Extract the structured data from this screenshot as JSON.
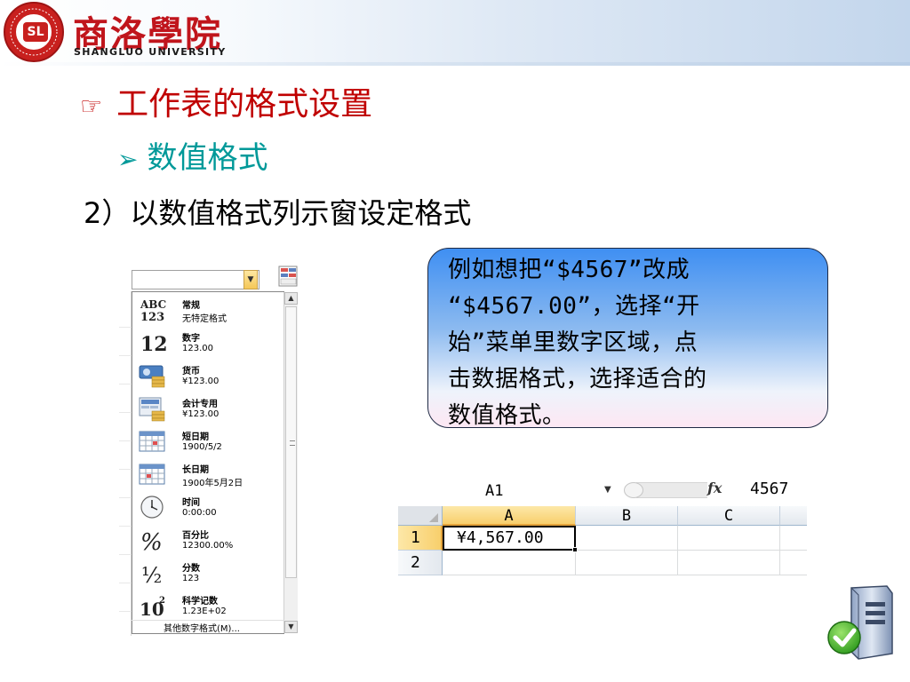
{
  "header": {
    "school_name_cn": "商洛學院",
    "school_name_en": "SHANGLUO UNIVERSITY",
    "seal_letters": "SL",
    "seal_ring_text": "SHANGLUO UNIVERSITY"
  },
  "title_main": "工作表的格式设置",
  "title_main_bullet": "☞",
  "title_sub": "数值格式",
  "title_sub_bullet": "➢",
  "subtitle_step": "2）以数值格式列示窗设定格式",
  "callout": {
    "lines": [
      "例如想把“$4567”改成",
      "“$4567.00”，选择“开",
      "始”菜单里数字区域，点",
      "击数据格式，选择适合的",
      "数值格式。"
    ]
  },
  "format_dropdown": {
    "items": [
      {
        "name": "常规",
        "example": "无特定格式",
        "icon": "abc123-icon"
      },
      {
        "name": "数字",
        "example": "123.00",
        "icon": "number-12-icon"
      },
      {
        "name": "货币",
        "example": "¥123.00",
        "icon": "currency-icon"
      },
      {
        "name": "会计专用",
        "example": "¥123.00",
        "icon": "accounting-icon"
      },
      {
        "name": "短日期",
        "example": "1900/5/2",
        "icon": "short-date-calendar-icon"
      },
      {
        "name": "长日期",
        "example": "1900年5月2日",
        "icon": "long-date-calendar-icon"
      },
      {
        "name": "时间",
        "example": "0:00:00",
        "icon": "clock-icon"
      },
      {
        "name": "百分比",
        "example": "12300.00%",
        "icon": "percent-icon"
      },
      {
        "name": "分数",
        "example": "123",
        "icon": "fraction-icon"
      },
      {
        "name": "科学记数",
        "example": "1.23E+02",
        "icon": "scientific-icon"
      }
    ],
    "more_label": "其他数字格式(M)..."
  },
  "excel": {
    "name_box": "A1",
    "fx_label": "fx",
    "formula_value": "4567",
    "columns": [
      "A",
      "B",
      "C"
    ],
    "rows": [
      "1",
      "2"
    ],
    "active_cell_value": "¥4,567.00"
  }
}
